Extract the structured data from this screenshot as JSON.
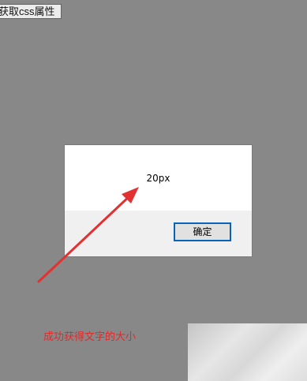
{
  "page": {
    "button_label": "获取css属性",
    "background_color": "#888888"
  },
  "dialog": {
    "message": "20px",
    "ok_label": "确定",
    "ok_border_color": "#0a63b8"
  },
  "annotation": {
    "caption": "成功获得文字的大小",
    "color": "#e02a2a",
    "arrow": "red-arrow-icon"
  }
}
